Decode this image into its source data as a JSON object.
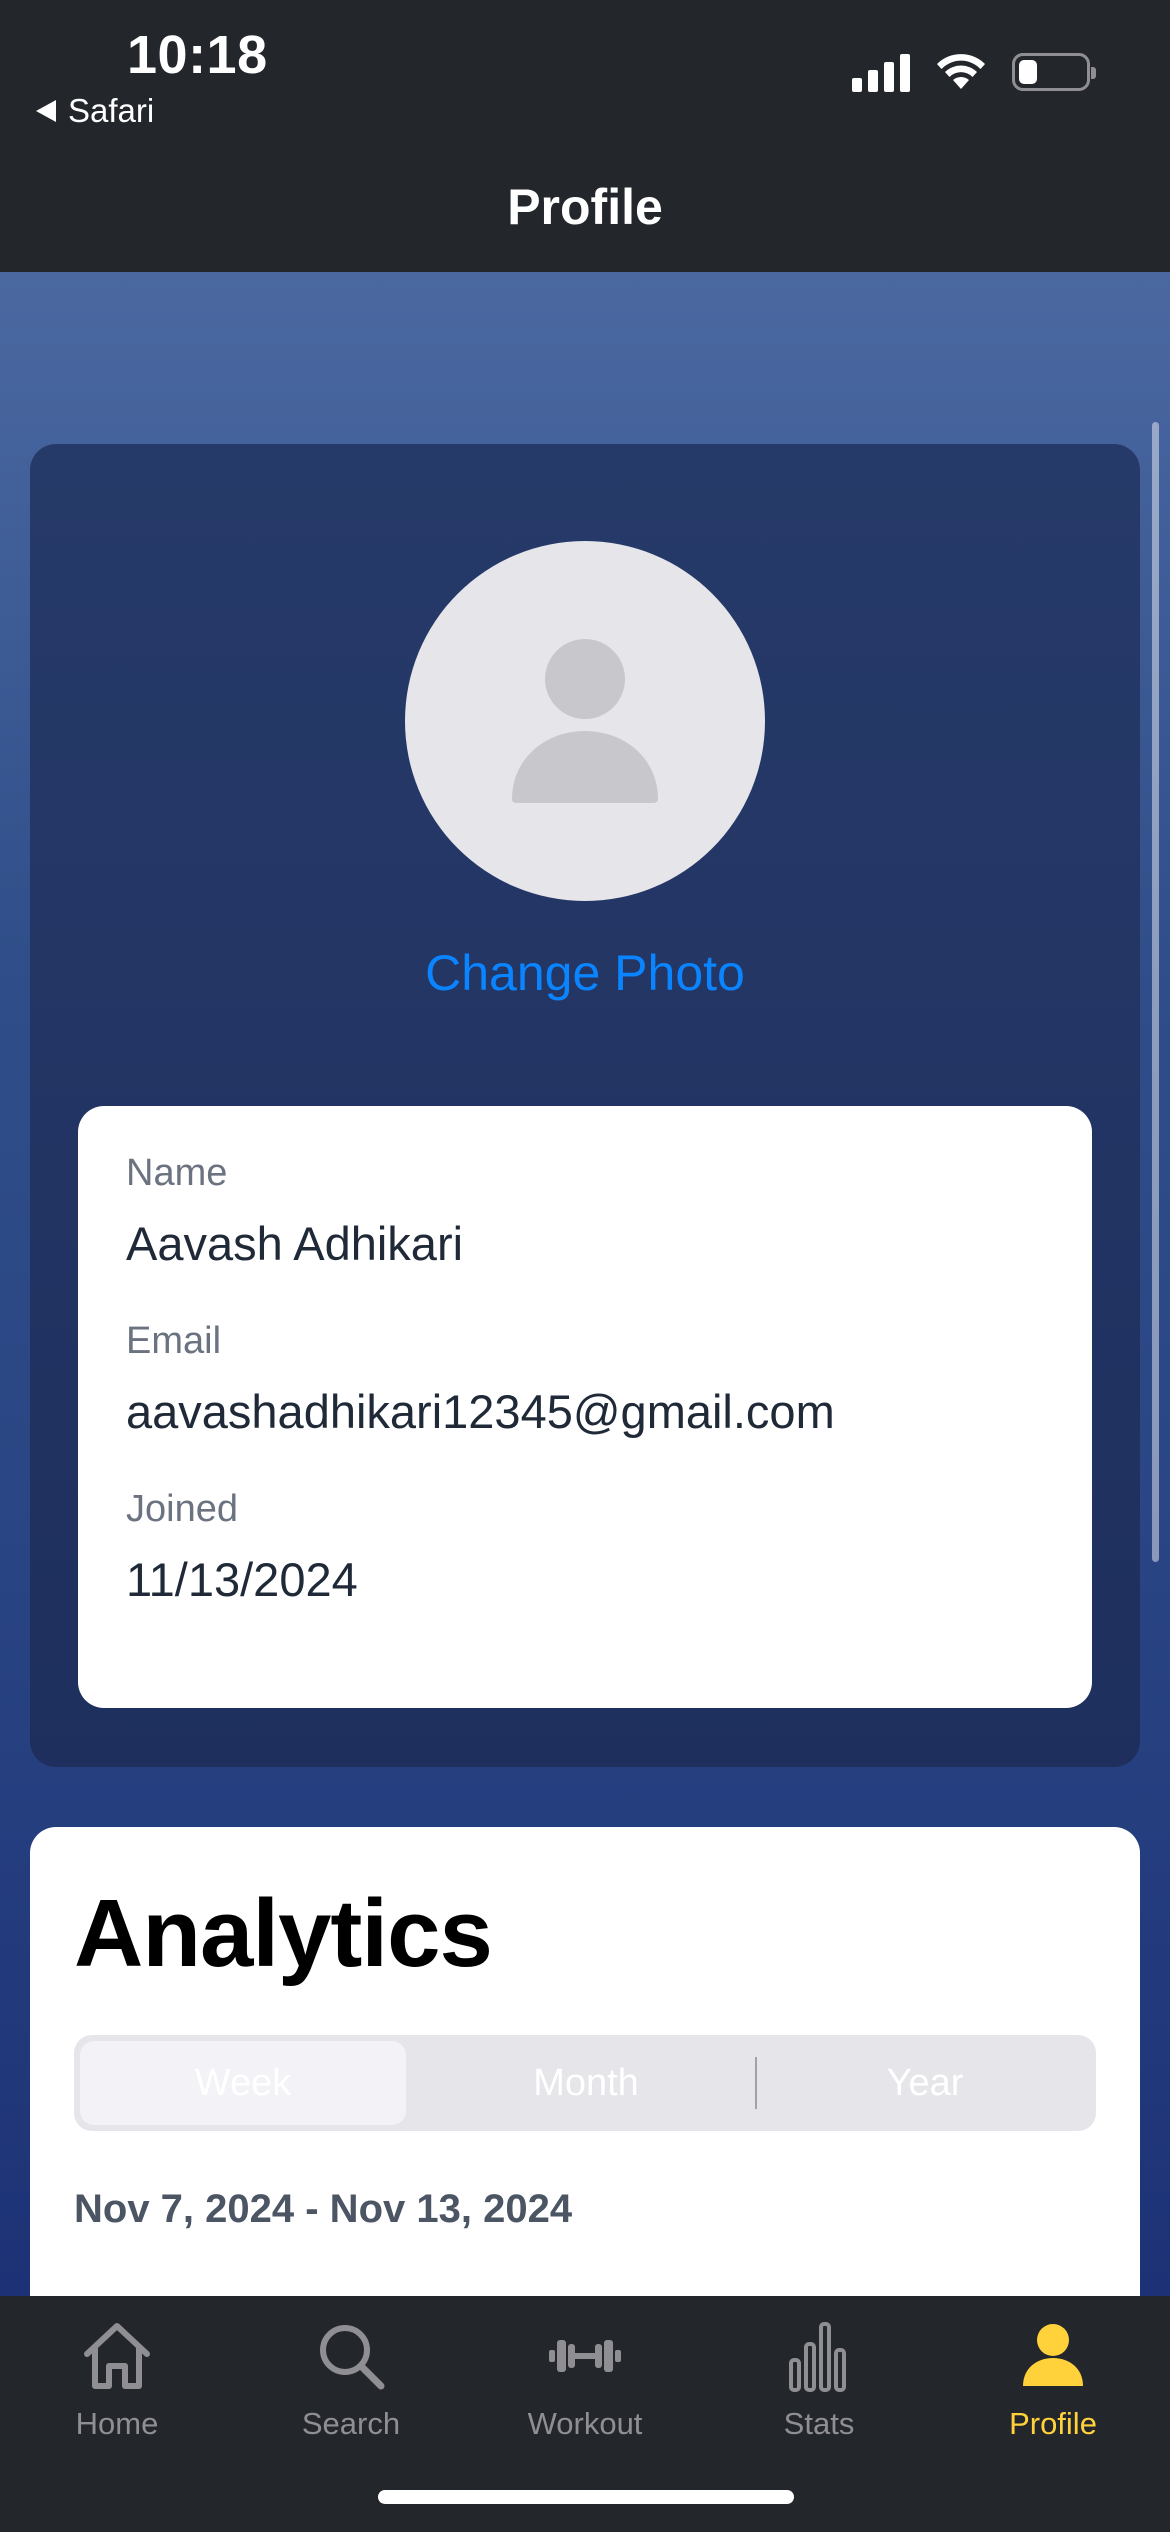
{
  "status_bar": {
    "time": "10:18",
    "back_app": "Safari",
    "icons": [
      "signal-icon",
      "wifi-icon",
      "battery-icon"
    ],
    "battery_level": 0.25
  },
  "nav": {
    "title": "Profile"
  },
  "profile": {
    "avatar_icon": "person-placeholder-icon",
    "change_photo_label": "Change Photo",
    "fields": [
      {
        "label": "Name",
        "value": "Aavash Adhikari"
      },
      {
        "label": "Email",
        "value": "aavashadhikari12345@gmail.com"
      },
      {
        "label": "Joined",
        "value": "11/13/2024"
      }
    ]
  },
  "analytics": {
    "title": "Analytics",
    "segments": [
      "Week",
      "Month",
      "Year"
    ],
    "selected_segment": "Week",
    "date_range": "Nov 7, 2024 - Nov 13, 2024"
  },
  "tabbar": {
    "items": [
      {
        "label": "Home",
        "icon": "house-icon"
      },
      {
        "label": "Search",
        "icon": "magnifier-icon"
      },
      {
        "label": "Workout",
        "icon": "dumbbell-icon"
      },
      {
        "label": "Stats",
        "icon": "bar-chart-icon"
      },
      {
        "label": "Profile",
        "icon": "person-icon"
      }
    ],
    "active": "Profile"
  },
  "colors": {
    "header_bg": "#23262b",
    "accent_link": "#0a84ff",
    "tab_active": "#ffd13b",
    "tab_inactive": "#8e8e93"
  }
}
